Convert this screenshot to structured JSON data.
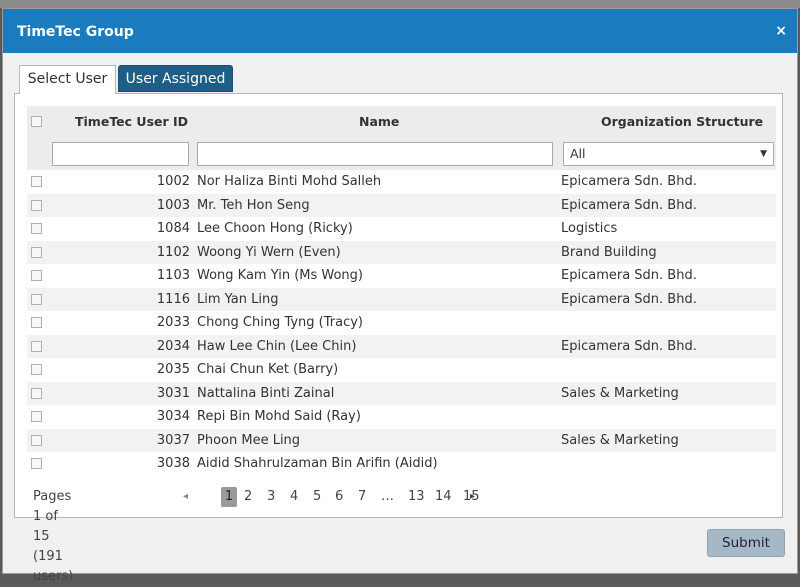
{
  "window": {
    "title": "TimeTec Group",
    "close_glyph": "×"
  },
  "tabs": [
    {
      "label": "Select User",
      "active": true
    },
    {
      "label": "User Assigned",
      "active": false
    }
  ],
  "table": {
    "columns": [
      "TimeTec User ID",
      "Name",
      "Organization Structure"
    ],
    "filters": {
      "id_value": "",
      "name_value": "",
      "org_selected": "All"
    },
    "rows": [
      {
        "id": "1002",
        "name": "Nor Haliza Binti Mohd Salleh",
        "org": "Epicamera Sdn. Bhd."
      },
      {
        "id": "1003",
        "name": "Mr. Teh Hon Seng",
        "org": "Epicamera Sdn. Bhd."
      },
      {
        "id": "1084",
        "name": "Lee Choon Hong (Ricky)",
        "org": "Logistics"
      },
      {
        "id": "1102",
        "name": "Woong Yi Wern (Even)",
        "org": "Brand Building"
      },
      {
        "id": "1103",
        "name": "Wong Kam Yin (Ms Wong)",
        "org": "Epicamera Sdn. Bhd."
      },
      {
        "id": "1116",
        "name": "Lim Yan Ling",
        "org": "Epicamera Sdn. Bhd."
      },
      {
        "id": "2033",
        "name": "Chong Ching Tyng (Tracy)",
        "org": ""
      },
      {
        "id": "2034",
        "name": "Haw Lee Chin (Lee Chin)",
        "org": "Epicamera Sdn. Bhd."
      },
      {
        "id": "2035",
        "name": "Chai Chun Ket (Barry)",
        "org": ""
      },
      {
        "id": "3031",
        "name": "Nattalina Binti Zainal",
        "org": "Sales & Marketing"
      },
      {
        "id": "3034",
        "name": "Repi Bin Mohd Said (Ray)",
        "org": ""
      },
      {
        "id": "3037",
        "name": "Phoon Mee Ling",
        "org": "Sales & Marketing"
      },
      {
        "id": "3038",
        "name": "Aidid Shahrulzaman Bin Arifin (Aidid)",
        "org": ""
      }
    ]
  },
  "pager": {
    "summary": "Pages 1 of 15 (191 users)",
    "prev_glyph": "◂",
    "next_glyph": "▸",
    "pages": [
      "1",
      "2",
      "3",
      "4",
      "5",
      "6",
      "7",
      "…",
      "13",
      "14",
      "15"
    ],
    "current": "1"
  },
  "actions": {
    "submit_label": "Submit"
  },
  "colors": {
    "titlebar": "#1a7bbf",
    "active_tab_inactive": "#1e5e86",
    "submit": "#a6b8c6"
  }
}
